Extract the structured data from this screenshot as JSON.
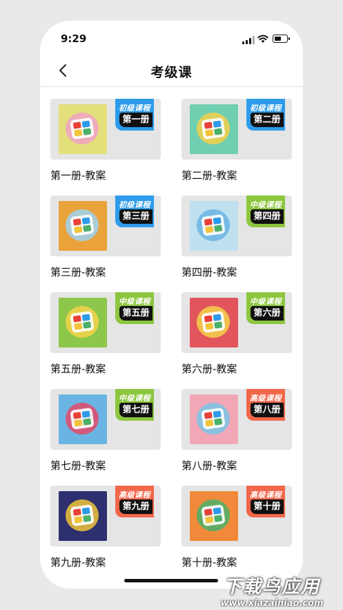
{
  "status_bar": {
    "time": "9:29"
  },
  "nav": {
    "title": "考级课"
  },
  "colors": {
    "beginner": "#2d9bea",
    "intermediate": "#8cc63f",
    "advanced": "#f2674a"
  },
  "courses": [
    {
      "level": "初级课程",
      "volume": "第一册",
      "label": "第一册-教案",
      "level_key": "beginner",
      "cover": "#e3df7a",
      "blob": "#f0a3c6"
    },
    {
      "level": "初级课程",
      "volume": "第二册",
      "label": "第二册-教案",
      "level_key": "beginner",
      "cover": "#6fcfb0",
      "blob": "#f4d04a"
    },
    {
      "level": "初级课程",
      "volume": "第三册",
      "label": "第三册-教案",
      "level_key": "beginner",
      "cover": "#eaa23a",
      "blob": "#9fd4f0"
    },
    {
      "level": "中级课程",
      "volume": "第四册",
      "label": "第四册-教案",
      "level_key": "intermediate",
      "cover": "#bfe0ef",
      "blob": "#6ab4e3"
    },
    {
      "level": "中级课程",
      "volume": "第五册",
      "label": "第五册-教案",
      "level_key": "intermediate",
      "cover": "#8cc64a",
      "blob": "#f3d34a"
    },
    {
      "level": "中级课程",
      "volume": "第六册",
      "label": "第六册-教案",
      "level_key": "intermediate",
      "cover": "#e2555c",
      "blob": "#f3d34a"
    },
    {
      "level": "中级课程",
      "volume": "第七册",
      "label": "第七册-教案",
      "level_key": "intermediate",
      "cover": "#6ab4e3",
      "blob": "#e24a6a"
    },
    {
      "level": "高级课程",
      "volume": "第八册",
      "label": "第八册-教案",
      "level_key": "advanced",
      "cover": "#f2a7b6",
      "blob": "#7ac4e8"
    },
    {
      "level": "高级课程",
      "volume": "第九册",
      "label": "第九册-教案",
      "level_key": "advanced",
      "cover": "#2d2f6e",
      "blob": "#f0c43a"
    },
    {
      "level": "高级课程",
      "volume": "第十册",
      "label": "第十册-教案",
      "level_key": "advanced",
      "cover": "#f08a3a",
      "blob": "#4ab06a"
    }
  ],
  "watermark": {
    "main": "下载鸟应用",
    "sub": "www.xiazainiao.com"
  }
}
